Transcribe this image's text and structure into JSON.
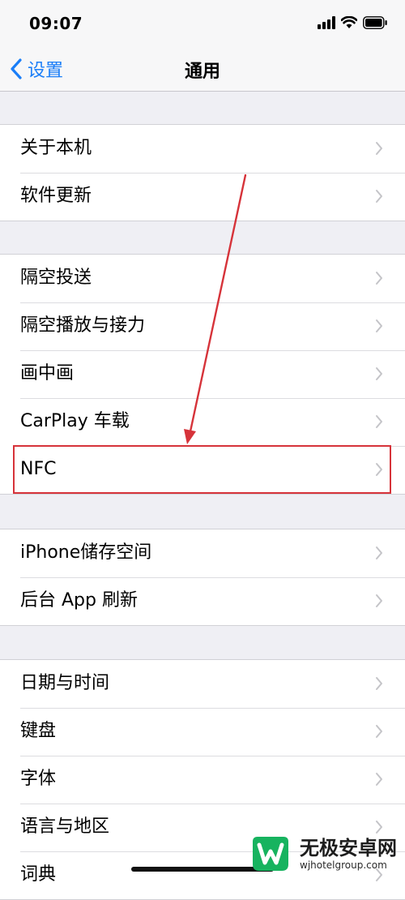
{
  "status_bar": {
    "time": "09:07",
    "icons": [
      "cellular-signal-icon",
      "wifi-icon",
      "battery-icon"
    ]
  },
  "nav": {
    "back_label": "设置",
    "title": "通用",
    "back_icon": "chevron-left-icon"
  },
  "groups": [
    {
      "rows": [
        {
          "label": "关于本机"
        },
        {
          "label": "软件更新"
        }
      ]
    },
    {
      "rows": [
        {
          "label": "隔空投送"
        },
        {
          "label": "隔空播放与接力"
        },
        {
          "label": "画中画"
        },
        {
          "label": "CarPlay 车载"
        },
        {
          "label": "NFC"
        }
      ]
    },
    {
      "rows": [
        {
          "label": "iPhone储存空间"
        },
        {
          "label": "后台 App 刷新"
        }
      ]
    },
    {
      "rows": [
        {
          "label": "日期与时间"
        },
        {
          "label": "键盘"
        },
        {
          "label": "字体"
        },
        {
          "label": "语言与地区"
        },
        {
          "label": "词典"
        }
      ]
    }
  ],
  "annotation": {
    "highlighted_row": "NFC",
    "color": "#d6333a"
  },
  "watermark": {
    "name": "无极安卓网",
    "url": "wjhotelgroup.com",
    "logo_color": "#17b35f"
  },
  "colors": {
    "accent": "#1a7ef8",
    "background": "#efeff4",
    "cell": "#ffffff"
  }
}
